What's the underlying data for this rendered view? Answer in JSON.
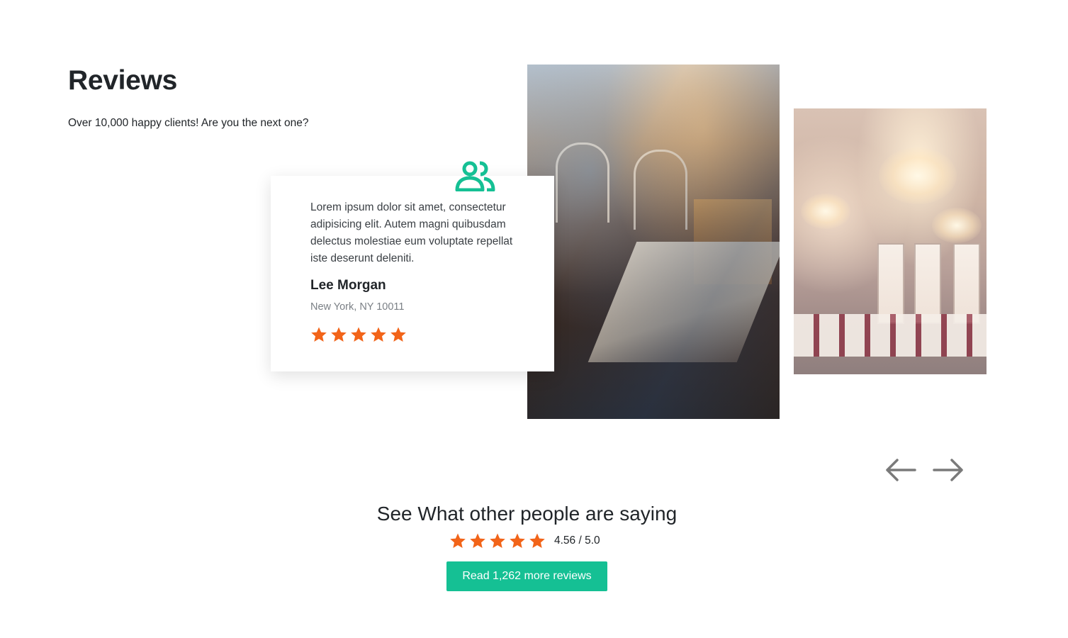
{
  "section": {
    "title": "Reviews",
    "subtitle": "Over 10,000 happy clients! Are you the next one?"
  },
  "review": {
    "icon": "users-icon",
    "text": "Lorem ipsum dolor sit amet, consectetur adipisicing elit. Autem magni quibusdam delectus molestiae eum voluptate repellat iste deserunt deleniti.",
    "name": "Lee Morgan",
    "location": "New York, NY 10011",
    "stars": 5
  },
  "images": {
    "main": "restaurant-interior-photo",
    "side": "ballroom-chandelier-photo"
  },
  "navigation": {
    "prev_icon": "arrow-left-icon",
    "next_icon": "arrow-right-icon"
  },
  "summary": {
    "heading": "See What other people are saying",
    "stars": 5,
    "rating_text": "4.56 / 5.0",
    "button_label": "Read 1,262 more reviews"
  },
  "colors": {
    "accent": "#15c094",
    "star": "#f26419",
    "arrow": "#7a7a7a"
  }
}
